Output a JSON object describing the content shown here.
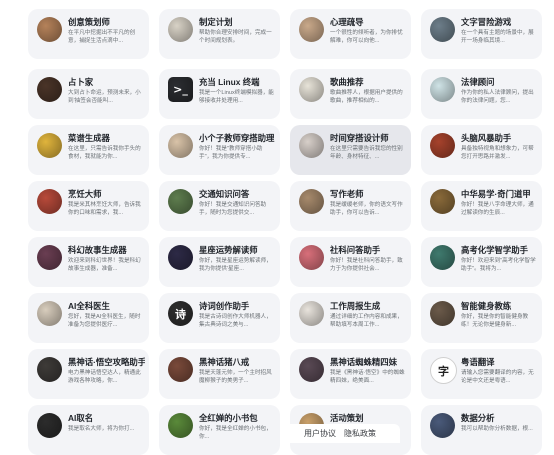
{
  "cards": [
    {
      "title": "创意策划师",
      "desc": "在平凡中挖掘出不平凡的创意，捕捉生活点滴中...",
      "icon": "planner-avatar-icon",
      "color": "#b5825a"
    },
    {
      "title": "制定计划",
      "desc": "帮助你合理安排时间，完成一个时间规划表。",
      "icon": "calendar-plan-icon",
      "color": "#d8d2c6"
    },
    {
      "title": "心理疏导",
      "desc": "一个很性的倾听者，为你排忧解难，你可以向他...",
      "icon": "counselor-avatar-icon",
      "color": "#c9a98a"
    },
    {
      "title": "文字冒险游戏",
      "desc": "在一个具有主题的场景中，展开一场身临其境...",
      "icon": "adventure-scene-icon",
      "color": "#6d7e8a"
    },
    {
      "title": "占卜家",
      "desc": "大到占卜命运，预测未来，小到'抽签会否能叫...",
      "icon": "fortune-teller-icon",
      "color": "#4a3428"
    },
    {
      "title": "充当 Linux 终端",
      "desc": "我是一个Linux终端模拟器，能够接收并处理用...",
      "icon": "terminal-icon",
      "color": "#2b2d31"
    },
    {
      "title": "歌曲推荐",
      "desc": "歌曲推荐人，根据用户提供的歌曲，推荐相似的...",
      "icon": "music-recommend-icon",
      "color": "#e7e3d8"
    },
    {
      "title": "法律顾问",
      "desc": "作为你的私人法律顾问，提出你的法律问题，您...",
      "icon": "law-advisor-icon",
      "color": "#cfe3e6"
    },
    {
      "title": "菜谱生成器",
      "desc": "在这里，只需告诉我你手头的食材，我就能为你...",
      "icon": "recipe-icon",
      "color": "#e0b43c"
    },
    {
      "title": "小个子教师穿搭助理",
      "desc": "你好！我是\"教师穿搭小助手\"，我为你提供专...",
      "icon": "teacher-outfit-icon",
      "color": "#d9c3a8"
    },
    {
      "title": "时间穿搭设计师",
      "desc": "在这里只需要告诉我您的性别年龄、身材特征、...",
      "icon": "fashion-designer-icon",
      "color": "#d7cfc9"
    },
    {
      "title": "头脑风暴助手",
      "desc": "具备独特视角和想象力，可帮您打开思路并激发...",
      "icon": "brainstorm-icon",
      "color": "#a6422c"
    },
    {
      "title": "烹饪大师",
      "desc": "我是米其林烹饪大师，告诉我你的口味和需求，我...",
      "icon": "chef-icon",
      "color": "#b84a3a"
    },
    {
      "title": "交通知识问答",
      "desc": "你好！我是交通知识问答助手，随时为您提供交...",
      "icon": "traffic-icon",
      "color": "#5e7d4e"
    },
    {
      "title": "写作老师",
      "desc": "我是缓缓老师，你的语文写作助手，你可以告诉...",
      "icon": "writing-teacher-icon",
      "color": "#a78a6c"
    },
    {
      "title": "中华易学·奇门道甲",
      "desc": "你好！我是八字命理大师，通过解读你的生辰...",
      "icon": "yijing-icon",
      "color": "#8a6a3a"
    },
    {
      "title": "科幻故事生成器",
      "desc": "欢迎来到科幻世界！我是科幻故事生成器，准备...",
      "icon": "scifi-icon",
      "color": "#6a3e52"
    },
    {
      "title": "星座运势解读师",
      "desc": "你好，我是星座运势解读师，我为你提供'星座...",
      "icon": "zodiac-icon",
      "color": "#2d2a46"
    },
    {
      "title": "社科问答助手",
      "desc": "你好！我是社科问答助手，致力于为你提供社会...",
      "icon": "social-science-icon",
      "color": "#d86f7a"
    },
    {
      "title": "高考化学智学助手",
      "desc": "你好！欢迎来到\"高考化学智学助手\"。我将为...",
      "icon": "chemistry-icon",
      "color": "#3f7a6e"
    },
    {
      "title": "AI全科医生",
      "desc": "您好，我是AI全科医生，随时准备为您提供医疗...",
      "icon": "doctor-icon",
      "color": "#d8cdbd"
    },
    {
      "title": "诗词创作助手",
      "desc": "我是古诗词创作大师机器人，集古典诗词之美与...",
      "icon": "poetry-icon",
      "color": "#2f2f2f"
    },
    {
      "title": "工作周报生成",
      "desc": "通过详细的工作内容和成果，帮助填写本周工作...",
      "icon": "weekly-report-icon",
      "color": "#e8e3dc"
    },
    {
      "title": "智能健身教练",
      "desc": "你好，我是你的智能健身教练！无论你是健身新...",
      "icon": "fitness-icon",
      "color": "#6b5a4a"
    },
    {
      "title": "黑神话·悟空攻略助手",
      "desc": "电力黑神话悟空达人，精通此游戏各种攻略，你...",
      "icon": "wukong-guide-icon",
      "color": "#3e3b38"
    },
    {
      "title": "黑神话猪八戒",
      "desc": "我是天蓬元帅，一个主时招风魔柳猴子的美男子...",
      "icon": "zhubajie-icon",
      "color": "#7a4a3a"
    },
    {
      "title": "黑神话蜘蛛精四妹",
      "desc": "我是《黑神话·悟空》中的蜘蛛精四妹，绝美面...",
      "icon": "spider-demon-icon",
      "color": "#5a4a55"
    },
    {
      "title": "粤语翻译",
      "desc": "请输入您需要翻译的内容，无论是中文还是粤语...",
      "icon": "cantonese-icon",
      "color": "#ffffff"
    },
    {
      "title": "AI取名",
      "desc": "我是取名大师，将为你打...",
      "icon": "naming-icon",
      "color": "#2c2c2c"
    },
    {
      "title": "全红婵的小书包",
      "desc": "你好，我是全红婵的小书包，你...",
      "icon": "schoolbag-icon",
      "color": "#5a8a3a"
    },
    {
      "title": "活动策划",
      "desc": "",
      "icon": "event-plan-icon",
      "color": "#c9a06a"
    },
    {
      "title": "数据分析",
      "desc": "我可以帮助你分析数据，根...",
      "icon": "data-analysis-icon",
      "color": "#4a5a7a"
    }
  ],
  "footer": {
    "terms": "用户协议",
    "privacy": "隐私政策"
  }
}
